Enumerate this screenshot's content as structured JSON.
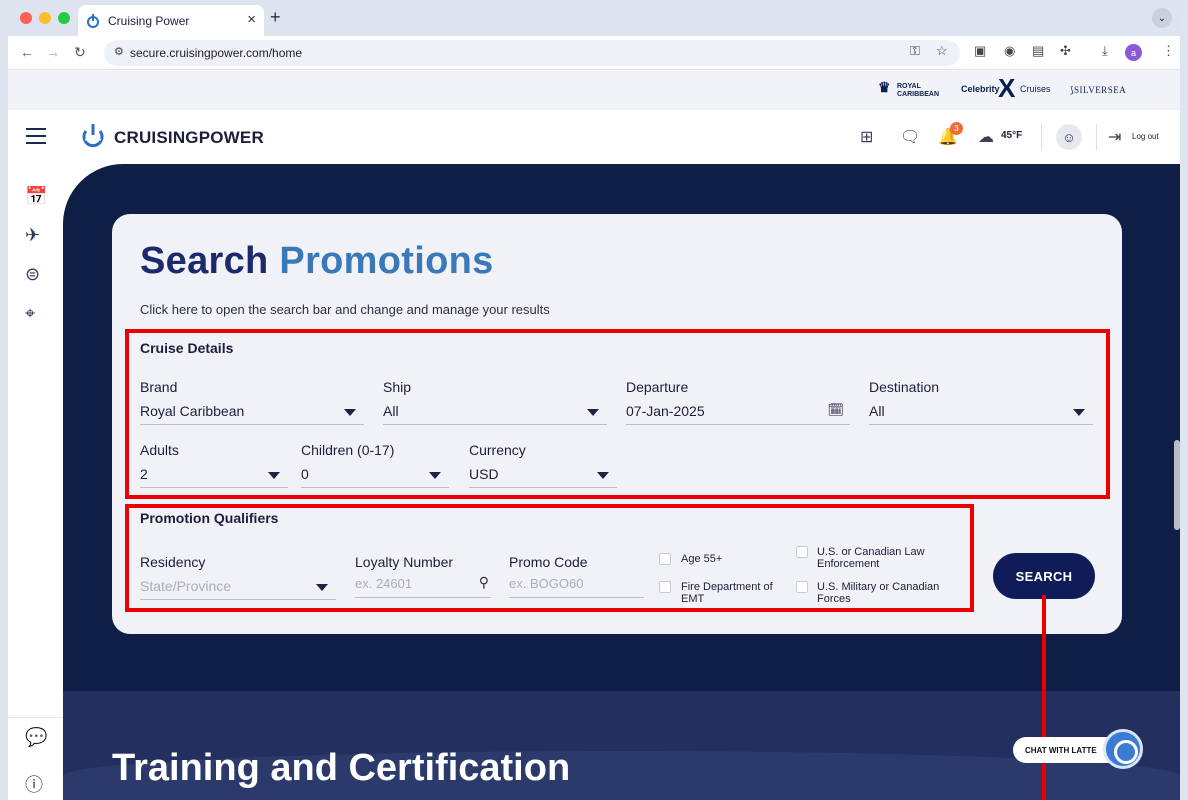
{
  "browser": {
    "tab_title": "Cruising Power",
    "tab_close": "×",
    "new_tab": "+",
    "url": "secure.cruisingpower.com/home",
    "profile_initial": "a"
  },
  "brands": {
    "royal_line1": "ROYAL",
    "royal_line2": "CARIBBEAN",
    "celebrity": "Celebrity",
    "celebrity_x": "X",
    "cruises": "Cruises",
    "silversea": "SILVERSEA"
  },
  "header": {
    "logo_text": "CRUISINGPOWER",
    "notification_count": "3",
    "temperature": "45°F",
    "logout_label": "Log out"
  },
  "search": {
    "title_part1": "Search",
    "title_part2": "Promotions",
    "subtitle": "Click here to open the search bar and change and manage your results",
    "cruise_details": {
      "heading": "Cruise Details",
      "brand_label": "Brand",
      "brand_value": "Royal Caribbean",
      "ship_label": "Ship",
      "ship_value": "All",
      "departure_label": "Departure",
      "departure_value": "07-Jan-2025",
      "destination_label": "Destination",
      "destination_value": "All",
      "adults_label": "Adults",
      "adults_value": "2",
      "children_label": "Children (0-17)",
      "children_value": "0",
      "currency_label": "Currency",
      "currency_value": "USD"
    },
    "qualifiers": {
      "heading": "Promotion Qualifiers",
      "residency_label": "Residency",
      "residency_placeholder": "State/Province",
      "loyalty_label": "Loyalty Number",
      "loyalty_placeholder": "ex. 24601",
      "promo_label": "Promo Code",
      "promo_placeholder": "ex. BOGO60",
      "check_age": "Age 55+",
      "check_law_1": "U.S. or Canadian Law",
      "check_law_2": "Enforcement",
      "check_fire_1": "Fire Department of",
      "check_fire_2": "EMT",
      "check_military_1": "U.S. Military or Canadian",
      "check_military_2": "Forces"
    },
    "search_button": "SEARCH"
  },
  "training": {
    "heading": "Training and Certification"
  },
  "chat": {
    "label": "CHAT WITH LATTE"
  },
  "colors": {
    "main_bg": "#0f1e44",
    "accent_blue": "#3a78b8",
    "title_navy": "#1c2a6b",
    "search_btn": "#0f1c58",
    "highlight_red": "#e90000",
    "badge_orange": "#f26b3a"
  }
}
